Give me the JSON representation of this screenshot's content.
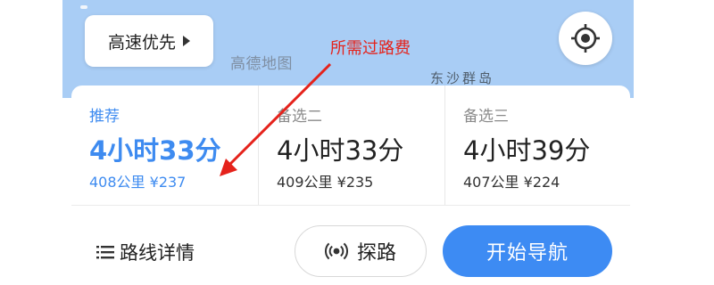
{
  "map": {
    "watermark": "高德地图",
    "place_label": "东沙群岛",
    "route_preference": "高速优先"
  },
  "annotation": {
    "text": "所需过路费",
    "color": "#e5221b"
  },
  "routes": [
    {
      "tag": "推荐",
      "time": "4小时33分",
      "distance": "408公里",
      "toll": "¥237",
      "selected": true
    },
    {
      "tag": "备选二",
      "time": "4小时33分",
      "distance": "409公里",
      "toll": "¥235",
      "selected": false
    },
    {
      "tag": "备选三",
      "time": "4小时39分",
      "distance": "407公里",
      "toll": "¥224",
      "selected": false
    }
  ],
  "actions": {
    "details_label": "路线详情",
    "probe_label": "探路",
    "start_label": "开始导航"
  },
  "colors": {
    "accent": "#3d8bf3",
    "map_water": "#a9cdf5"
  }
}
